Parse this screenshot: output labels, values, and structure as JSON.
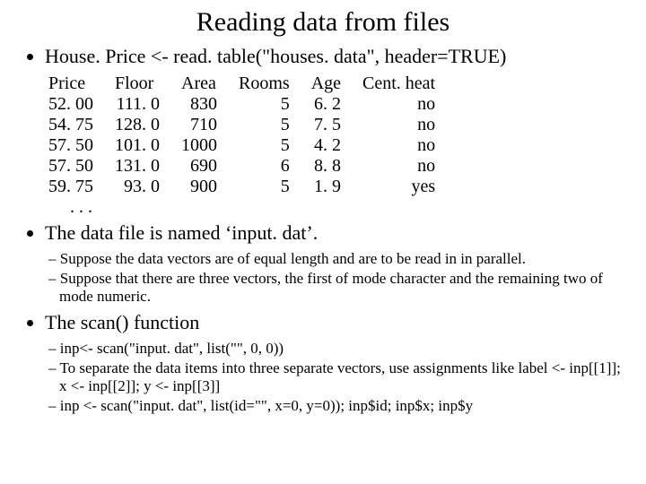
{
  "title": "Reading data from files",
  "bullet1": "House. Price <- read. table(\"houses. data\", header=TRUE)",
  "table": {
    "headers": [
      "Price",
      "Floor",
      "Area",
      "Rooms",
      "Age",
      "Cent. heat"
    ],
    "rows": [
      [
        "52. 00",
        "111. 0",
        "830",
        "5",
        "6. 2",
        "no"
      ],
      [
        "54. 75",
        "128. 0",
        "710",
        "5",
        "7. 5",
        "no"
      ],
      [
        "57. 50",
        "101. 0",
        "1000",
        "5",
        "4. 2",
        "no"
      ],
      [
        "57. 50",
        "131. 0",
        "690",
        "6",
        "8. 8",
        "no"
      ],
      [
        "59. 75",
        "93. 0",
        "900",
        "5",
        "1. 9",
        "yes"
      ]
    ],
    "ellipsis": ". . ."
  },
  "bullet2": "The data file is named ‘input. dat’.",
  "sub2": [
    "Suppose the data vectors are of equal length and are to be read in in parallel.",
    "Suppose that there are three vectors, the first of mode character and the remaining two of mode numeric."
  ],
  "bullet3": "The scan() function",
  "sub3": [
    "inp<- scan(\"input. dat\", list(\"\", 0, 0))",
    "To separate the data items into three separate vectors, use assignments like label <- inp[[1]]; x <- inp[[2]]; y <- inp[[3]]",
    "inp <- scan(\"input. dat\", list(id=\"\", x=0, y=0));  inp$id; inp$x; inp$y"
  ]
}
